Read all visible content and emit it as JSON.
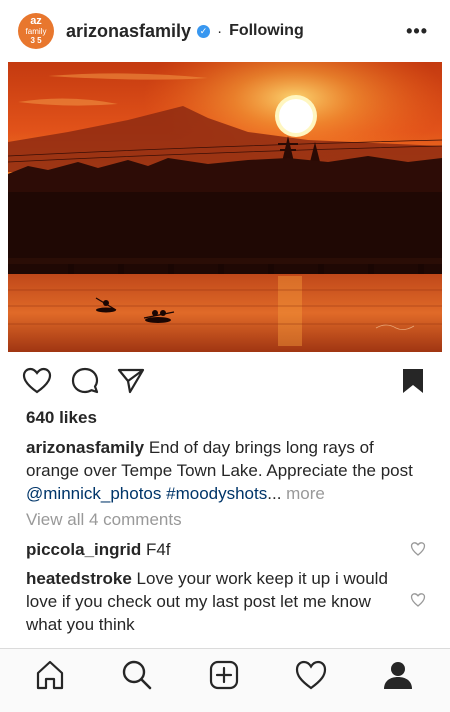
{
  "header": {
    "avatar": {
      "line1": "az",
      "line2": "family",
      "line3": "3 5"
    },
    "username": "arizonasfamily",
    "separator": "·",
    "follow_status": "Following",
    "more_icon": "more-horizontal-icon"
  },
  "post": {
    "image_description_icon": "sunset-photo",
    "likes": "640 likes",
    "caption": {
      "user": "arizonasfamily",
      "text": " End of day brings long rays of orange over Tempe Town Lake. Appreciate the post ",
      "mention": "@minnick_photos",
      "space": " ",
      "hashtag": "#moodyshots",
      "ellipsis": "...",
      "more": " more"
    },
    "view_all": "View all 4 comments",
    "comments": [
      {
        "user": "piccola_ingrid",
        "text": " F4f"
      },
      {
        "user": "heatedstroke",
        "text": " Love your work keep it up i would love if you check out my last post let me know what you think"
      }
    ]
  },
  "colors": {
    "accent_link": "#003569",
    "muted": "#999999",
    "verified": "#3897f0",
    "avatar": "#e8772e"
  }
}
